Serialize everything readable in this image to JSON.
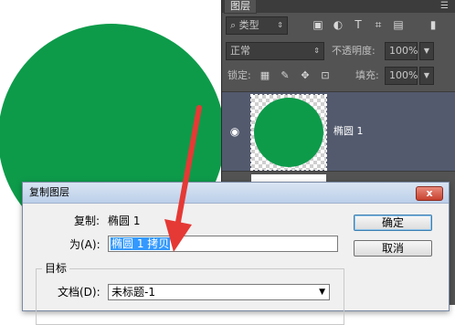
{
  "colors": {
    "shape_fill": "#0d9b4a",
    "panel_bg": "#535353",
    "selection": "#3399ff",
    "arrow": "#e53935"
  },
  "layers_panel": {
    "tab_label": "图层",
    "filter_kind": "类型",
    "blend_mode": "正常",
    "opacity_label": "不透明度:",
    "opacity_value": "100%",
    "lock_label": "锁定:",
    "fill_label": "填充:",
    "fill_value": "100%",
    "layers": [
      {
        "name": "椭圆 1",
        "visible": true
      }
    ]
  },
  "dialog": {
    "title": "复制图层",
    "close_label": "x",
    "copy_label": "复制:",
    "copy_value": "椭圆 1",
    "as_label": "为(A):",
    "as_value": "椭圆 1 拷贝",
    "ok_label": "确定",
    "cancel_label": "取消",
    "destination_label": "目标",
    "document_label": "文档(D):",
    "document_value": "未标题-1"
  }
}
